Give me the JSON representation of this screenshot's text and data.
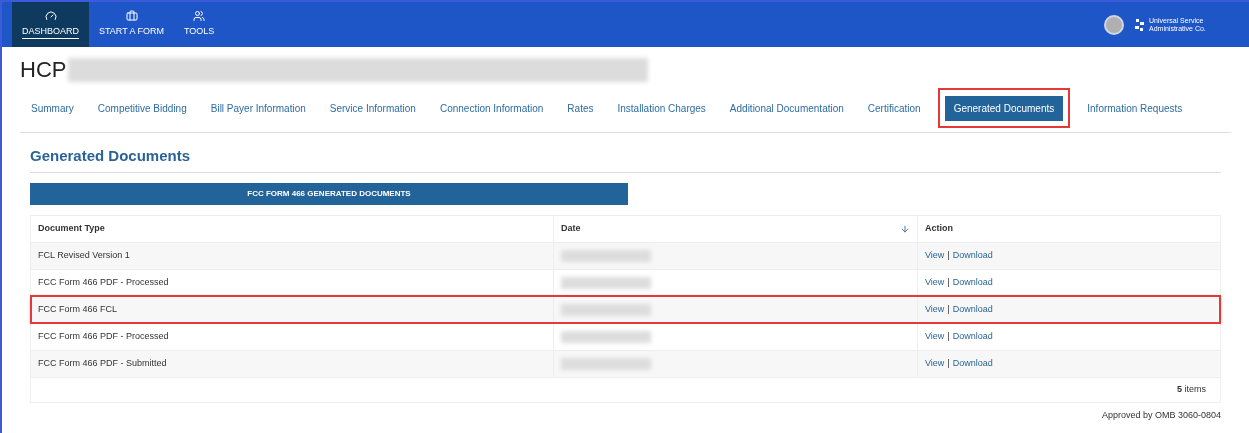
{
  "nav": {
    "items": [
      {
        "label": "DASHBOARD",
        "selected": true
      },
      {
        "label": "START A FORM",
        "selected": false
      },
      {
        "label": "TOOLS",
        "selected": false
      }
    ],
    "logo_text": "Universal Service Administrative Co."
  },
  "page_title": "HCP",
  "tabs": [
    {
      "label": "Summary",
      "selected": false,
      "annotated": false
    },
    {
      "label": "Competitive Bidding",
      "selected": false,
      "annotated": false
    },
    {
      "label": "Bill Payer Information",
      "selected": false,
      "annotated": false
    },
    {
      "label": "Service Information",
      "selected": false,
      "annotated": false
    },
    {
      "label": "Connection Information",
      "selected": false,
      "annotated": false
    },
    {
      "label": "Rates",
      "selected": false,
      "annotated": false
    },
    {
      "label": "Installation Charges",
      "selected": false,
      "annotated": false
    },
    {
      "label": "Additional Documentation",
      "selected": false,
      "annotated": false
    },
    {
      "label": "Certification",
      "selected": false,
      "annotated": false
    },
    {
      "label": "Generated Documents",
      "selected": true,
      "annotated": true
    },
    {
      "label": "Information Requests",
      "selected": false,
      "annotated": false
    }
  ],
  "section_title": "Generated Documents",
  "banner": "FCC FORM 466 GENERATED DOCUMENTS",
  "table": {
    "columns": [
      "Document Type",
      "Date",
      "Action"
    ],
    "rows": [
      {
        "document_type": "FCL Revised Version 1",
        "view": "View",
        "separator": "|",
        "download": "Download",
        "annotated": false
      },
      {
        "document_type": "FCC Form 466 PDF - Processed",
        "view": "View",
        "separator": "|",
        "download": "Download",
        "annotated": false
      },
      {
        "document_type": "FCC Form 466 FCL",
        "view": "View",
        "separator": "|",
        "download": "Download",
        "annotated": true
      },
      {
        "document_type": "FCC Form 466 PDF - Processed",
        "view": "View",
        "separator": "|",
        "download": "Download",
        "annotated": false
      },
      {
        "document_type": "FCC Form 466 PDF - Submitted",
        "view": "View",
        "separator": "|",
        "download": "Download",
        "annotated": false
      }
    ],
    "footer": "**5** items"
  },
  "approval": "Approved by OMB 3060-0804"
}
